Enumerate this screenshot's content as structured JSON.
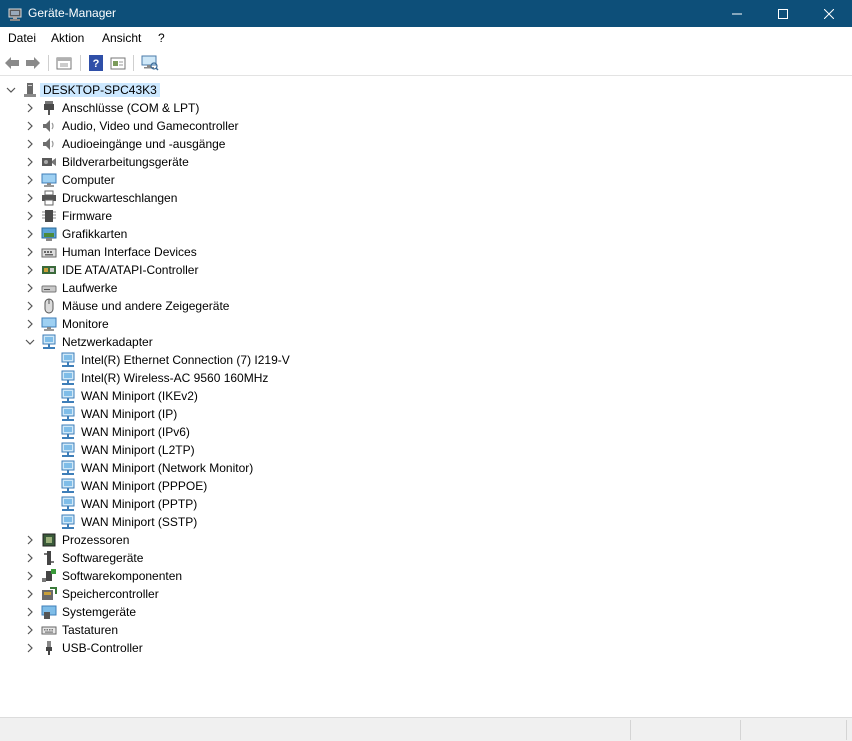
{
  "window": {
    "title": "Geräte-Manager"
  },
  "menu": [
    "Datei",
    "Aktion",
    "Ansicht",
    "?"
  ],
  "toolbar_icons": [
    "back-arrow-icon",
    "forward-arrow-icon",
    "properties-icon",
    "help-icon",
    "update-driver-icon",
    "scan-hardware-icon"
  ],
  "tree": {
    "root": "DESKTOP-SPC43K3",
    "categories": [
      {
        "label": "Anschlüsse (COM & LPT)",
        "icon": "port-icon"
      },
      {
        "label": "Audio, Video und Gamecontroller",
        "icon": "speaker-icon"
      },
      {
        "label": "Audioeingänge und -ausgänge",
        "icon": "speaker-icon"
      },
      {
        "label": "Bildverarbeitungsgeräte",
        "icon": "camera-icon"
      },
      {
        "label": "Computer",
        "icon": "computer-icon"
      },
      {
        "label": "Druckwarteschlangen",
        "icon": "printer-icon"
      },
      {
        "label": "Firmware",
        "icon": "chip-icon"
      },
      {
        "label": "Grafikkarten",
        "icon": "display-adapter-icon"
      },
      {
        "label": "Human Interface Devices",
        "icon": "hid-icon"
      },
      {
        "label": "IDE ATA/ATAPI-Controller",
        "icon": "ide-controller-icon"
      },
      {
        "label": "Laufwerke",
        "icon": "drive-icon"
      },
      {
        "label": "Mäuse und andere Zeigegeräte",
        "icon": "mouse-icon"
      },
      {
        "label": "Monitore",
        "icon": "monitor-icon"
      }
    ],
    "network": {
      "label": "Netzwerkadapter",
      "icon": "network-adapter-icon",
      "children": [
        "Intel(R) Ethernet Connection (7) I219-V",
        "Intel(R) Wireless-AC 9560 160MHz",
        "WAN Miniport (IKEv2)",
        "WAN Miniport (IP)",
        "WAN Miniport (IPv6)",
        "WAN Miniport (L2TP)",
        "WAN Miniport (Network Monitor)",
        "WAN Miniport (PPPOE)",
        "WAN Miniport (PPTP)",
        "WAN Miniport (SSTP)"
      ]
    },
    "categories_after": [
      {
        "label": "Prozessoren",
        "icon": "processor-icon"
      },
      {
        "label": "Softwaregeräte",
        "icon": "software-device-icon"
      },
      {
        "label": "Softwarekomponenten",
        "icon": "software-component-icon"
      },
      {
        "label": "Speichercontroller",
        "icon": "storage-controller-icon"
      },
      {
        "label": "Systemgeräte",
        "icon": "system-device-icon"
      },
      {
        "label": "Tastaturen",
        "icon": "keyboard-icon"
      },
      {
        "label": "USB-Controller",
        "icon": "usb-icon"
      }
    ]
  },
  "colors": {
    "titlebar": "#0d4f79",
    "selection": "#cce8ff"
  }
}
